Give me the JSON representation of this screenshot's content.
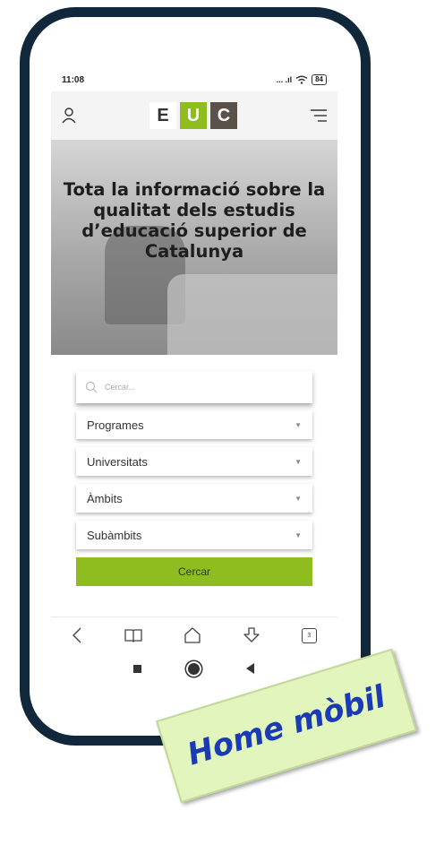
{
  "statusbar": {
    "time": "11:08",
    "signal": "... .ıl",
    "battery": "84"
  },
  "header": {
    "logo": [
      "E",
      "U",
      "C"
    ],
    "user_icon": "user-icon",
    "menu_icon": "menu-icon"
  },
  "hero": {
    "title": "Tota la informació sobre la qualitat dels estudis d’educació superior de Catalunya"
  },
  "search": {
    "placeholder": "Cercar..."
  },
  "filters": [
    "Programes",
    "Universitats",
    "Àmbits",
    "Subàmbits"
  ],
  "submit_label": "Cercar",
  "browser_nav": {
    "tabs_count": "3"
  },
  "badge_text": "Home mòbil",
  "colors": {
    "accent": "#8fbc1f",
    "frame": "#11273b",
    "badge_bg": "#e2f5bc",
    "badge_text": "#1a3bb5"
  }
}
